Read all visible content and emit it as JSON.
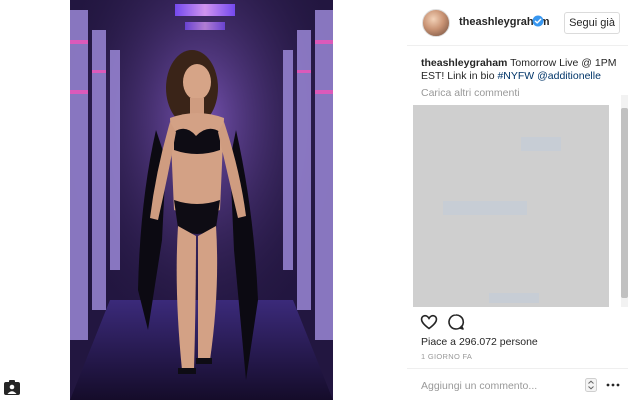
{
  "post": {
    "username": "theashleygraham",
    "follow_label": "Segui già",
    "caption_user": "theashleygraham",
    "caption_text": " Tomorrow Live @ 1PM EST! Link in bio ",
    "caption_hashtag": "#NYFW",
    "caption_mention": "@additionelle",
    "load_more_comments": "Carica altri commenti",
    "likes_text": "Piace a 296.072 persone",
    "timestamp": "1 GIORNO FA",
    "comment_placeholder": "Aggiungi un commento..."
  },
  "icons": {
    "heart": "heart-icon",
    "comment": "comment-icon",
    "verified": "verified-badge-icon",
    "more": "more-options-icon",
    "report": "report-icon"
  },
  "colors": {
    "verified_blue": "#3897f0",
    "link_color": "#003569",
    "ad_gray": "#cfcfcf",
    "photo_neon": "#7b4dff"
  }
}
